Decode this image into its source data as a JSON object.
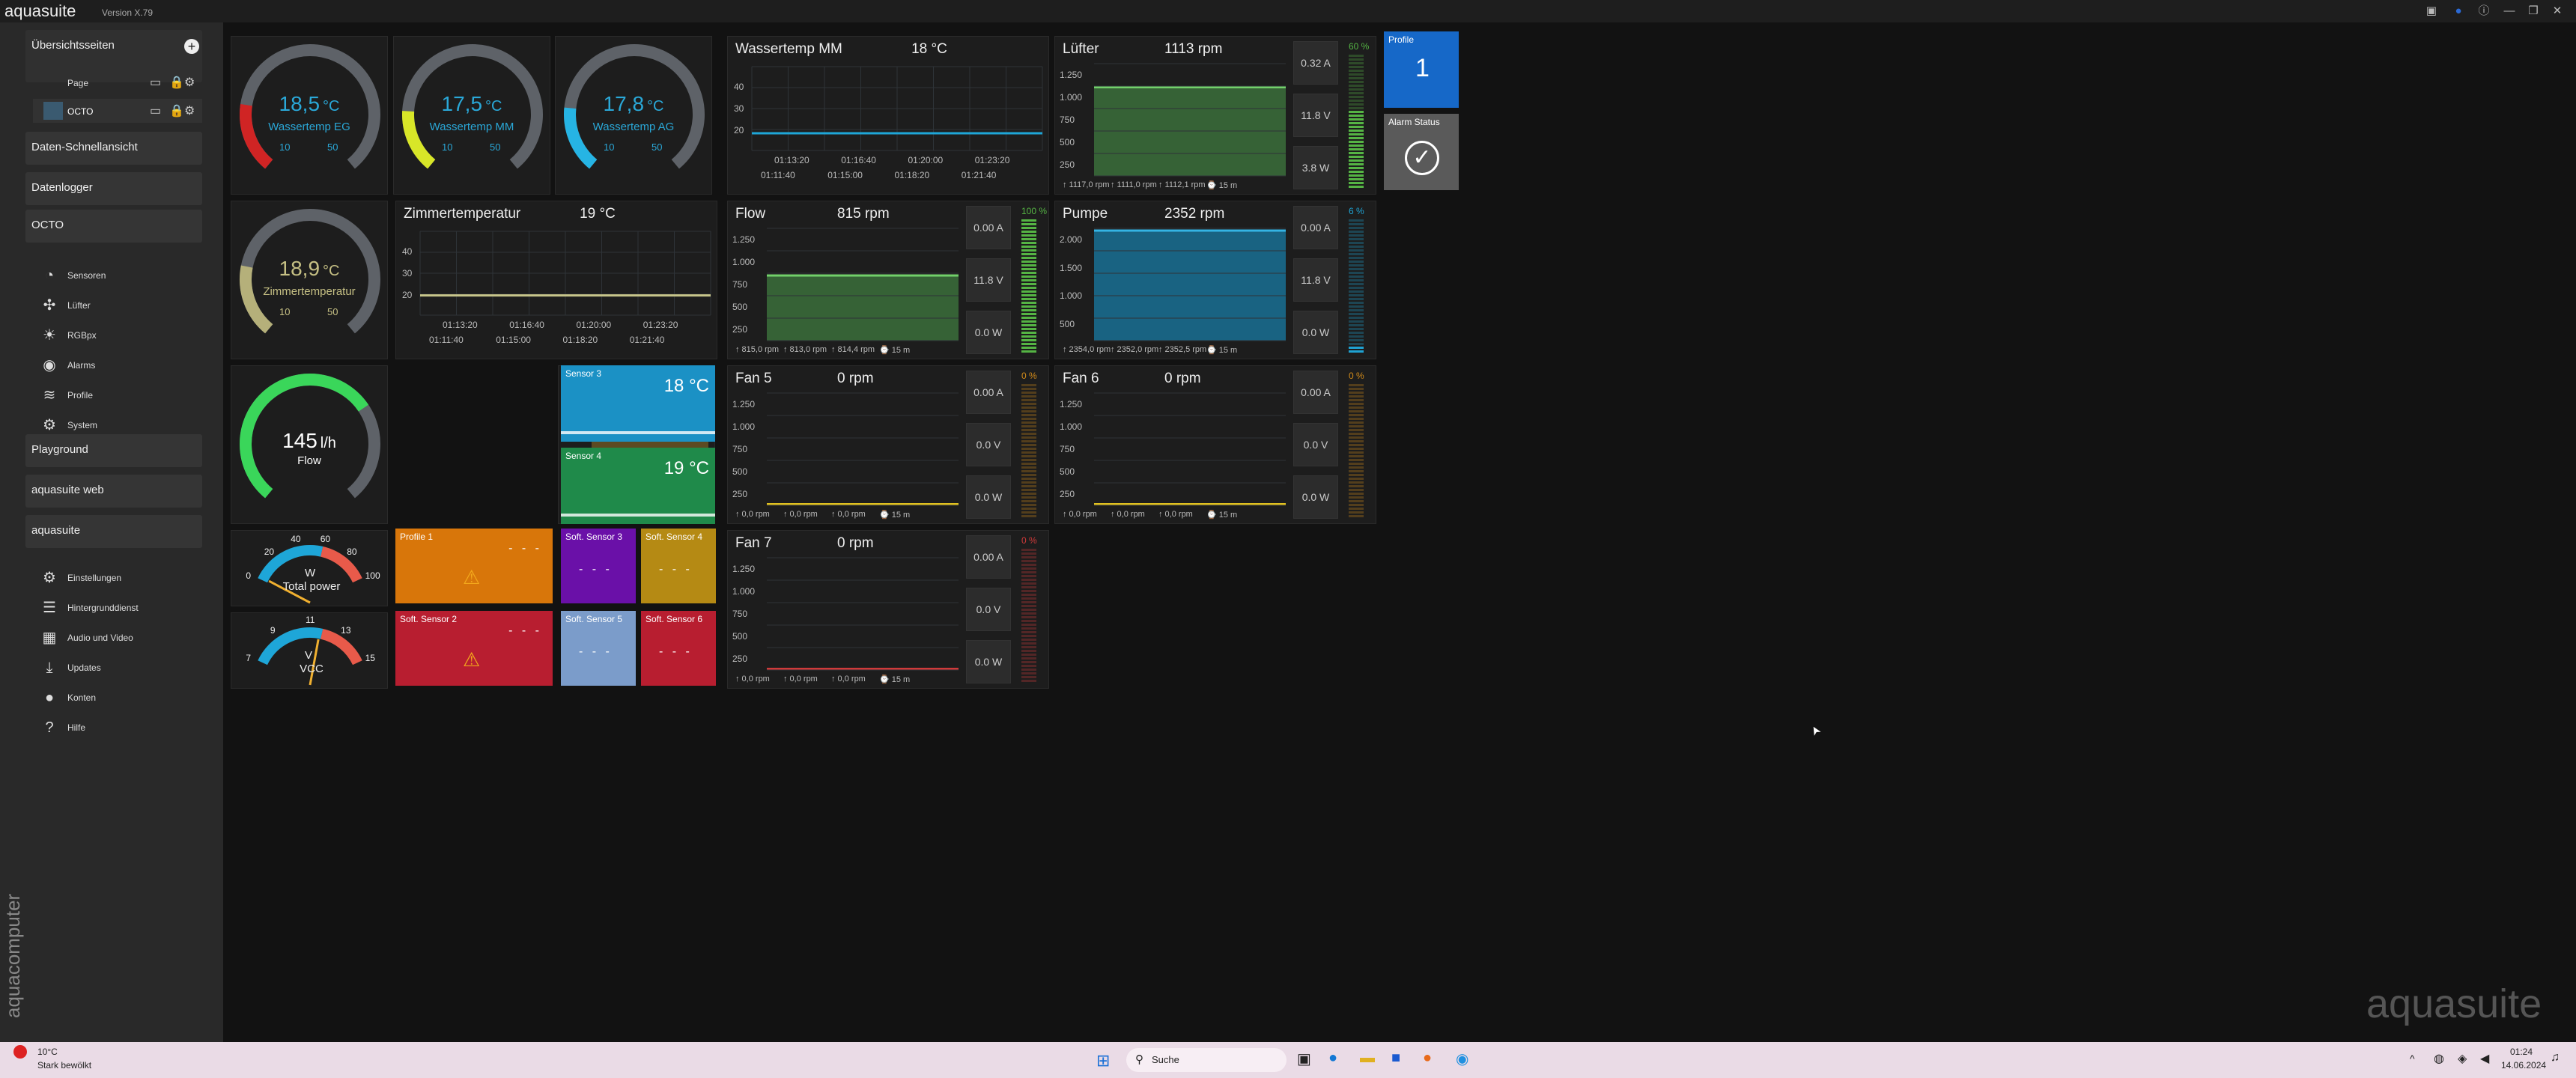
{
  "app": {
    "name": "aquasuite",
    "version": "Version X.79"
  },
  "window": {
    "icons": [
      "screenshot-icon",
      "globe-icon",
      "info-icon"
    ],
    "min": "—",
    "restore": "❐",
    "close": "✕"
  },
  "sidebar": {
    "overview": "Übersichtsseiten",
    "add": "+",
    "pages": [
      {
        "label": "Page"
      },
      {
        "label": "OCTO"
      }
    ],
    "quick": "Daten-Schnellansicht",
    "logger": "Datenlogger",
    "octo": "OCTO",
    "octo_items": [
      {
        "label": "Sensoren",
        "icon": "gauge-icon",
        "g": "◔"
      },
      {
        "label": "Lüfter",
        "icon": "fan-icon",
        "g": "✣"
      },
      {
        "label": "RGBpx",
        "icon": "bulb-icon",
        "g": "☀"
      },
      {
        "label": "Alarms",
        "icon": "alarm-icon",
        "g": "◉"
      },
      {
        "label": "Profile",
        "icon": "layers-icon",
        "g": "≋"
      },
      {
        "label": "System",
        "icon": "gear-icon",
        "g": "⚙"
      }
    ],
    "playground": "Playground",
    "web": "aquasuite web",
    "aquasuite": "aquasuite",
    "aq_items": [
      {
        "label": "Einstellungen",
        "icon": "gear-icon",
        "g": "⚙"
      },
      {
        "label": "Hintergrunddienst",
        "icon": "list-icon",
        "g": "☰"
      },
      {
        "label": "Audio und Video",
        "icon": "film-icon",
        "g": "▦"
      },
      {
        "label": "Updates",
        "icon": "download-icon",
        "g": "⤓"
      },
      {
        "label": "Konten",
        "icon": "user-icon",
        "g": "●"
      },
      {
        "label": "Hilfe",
        "icon": "help-icon",
        "g": "?"
      }
    ],
    "brand": "aquacomputer"
  },
  "gauges": [
    {
      "v": "18,5",
      "u": "°C",
      "label": "Wassertemp EG",
      "min": "10",
      "max": "50",
      "frac": 0.21,
      "color": "#d02424",
      "text": "#2aa8d8"
    },
    {
      "v": "17,5",
      "u": "°C",
      "label": "Wassertemp MM",
      "min": "10",
      "max": "50",
      "frac": 0.19,
      "color": "#d8e628",
      "text": "#2aa8d8"
    },
    {
      "v": "17,8",
      "u": "°C",
      "label": "Wassertemp AG",
      "min": "10",
      "max": "50",
      "frac": 0.2,
      "color": "#26b4e4",
      "text": "#2aa8d8"
    },
    {
      "v": "18,9",
      "u": "°C",
      "label": "Zimmertemperatur",
      "min": "10",
      "max": "50",
      "frac": 0.22,
      "color": "#b5b07a",
      "text": "#c6c084"
    },
    {
      "v": "145",
      "u": "l/h",
      "label": "Flow",
      "frac": 0.7,
      "color": "#3ad65a",
      "text": "#fff"
    }
  ],
  "lines": [
    {
      "title": "Wassertemp MM",
      "value": "18 °C",
      "y": [
        "40",
        "30",
        "20"
      ],
      "x": [
        "01:11:40",
        "01:15:00",
        "01:18:20",
        "01:21:40"
      ],
      "x2": [
        "01:13:20",
        "01:16:40",
        "01:20:00",
        "01:23:20"
      ],
      "color": "#1ea6d8",
      "level": 0.17
    },
    {
      "title": "Zimmertemperatur",
      "value": "19 °C",
      "y": [
        "40",
        "30",
        "20"
      ],
      "x": [
        "01:11:40",
        "01:15:00",
        "01:18:20",
        "01:21:40"
      ],
      "x2": [
        "01:13:20",
        "01:16:40",
        "01:20:00",
        "01:23:20"
      ],
      "color": "#c7c58a",
      "level": 0.2
    }
  ],
  "fans": [
    {
      "title": "Lüfter",
      "value": "1113 rpm",
      "a": "0.32 A",
      "v": "11.8 V",
      "w": "3.8 W",
      "pct": "60 %",
      "pctv": 0.6,
      "bcolor": "#55b444",
      "fill": "#3a6a3a",
      "line": "#72d06a",
      "level": 0.79,
      "y": [
        "1.250",
        "1.000",
        "750",
        "500",
        "250"
      ],
      "foot": [
        "↑ 1117,0 rpm",
        "↑ 1111,0 rpm",
        "↑ 1112,1 rpm",
        "⌚ 15 m"
      ]
    },
    {
      "title": "Flow",
      "value": "815 rpm",
      "a": "0.00 A",
      "v": "11.8 V",
      "w": "0.0 W",
      "pct": "100 %",
      "pctv": 1,
      "bcolor": "#55b444",
      "fill": "#3a6a3a",
      "line": "#72d06a",
      "level": 0.58,
      "y": [
        "1.250",
        "1.000",
        "750",
        "500",
        "250"
      ],
      "foot": [
        "↑ 815,0 rpm",
        "↑ 813,0 rpm",
        "↑ 814,4 rpm",
        "⌚ 15 m"
      ]
    },
    {
      "title": "Pumpe",
      "value": "2352 rpm",
      "a": "0.00 A",
      "v": "11.8 V",
      "w": "0.0 W",
      "pct": "6 %",
      "pctv": 0.06,
      "bcolor": "#1fa2d2",
      "fill": "#1a6c8e",
      "line": "#34b4e4",
      "level": 0.98,
      "y": [
        "2.000",
        "1.500",
        "1.000",
        "500"
      ],
      "foot": [
        "↑ 2354,0 rpm",
        "↑ 2352,0 rpm",
        "↑ 2352,5 rpm",
        "⌚ 15 m"
      ]
    },
    {
      "title": "Fan 5",
      "value": "0 rpm",
      "a": "0.00 A",
      "v": "0.0 V",
      "w": "0.0 W",
      "pct": "0 %",
      "pctv": 0,
      "bcolor": "#d28b1a",
      "fill": "#1d1d1d",
      "line": "#e0c020",
      "level": 0.01,
      "y": [
        "1.250",
        "1.000",
        "750",
        "500",
        "250"
      ],
      "foot": [
        "↑ 0,0 rpm",
        "↑ 0,0 rpm",
        "↑ 0,0 rpm",
        "⌚ 15 m"
      ]
    },
    {
      "title": "Fan 6",
      "value": "0 rpm",
      "a": "0.00 A",
      "v": "0.0 V",
      "w": "0.0 W",
      "pct": "0 %",
      "pctv": 0,
      "bcolor": "#d28b1a",
      "fill": "#1d1d1d",
      "line": "#e0c020",
      "level": 0.01,
      "y": [
        "1.250",
        "1.000",
        "750",
        "500",
        "250"
      ],
      "foot": [
        "↑ 0,0 rpm",
        "↑ 0,0 rpm",
        "↑ 0,0 rpm",
        "⌚ 15 m"
      ]
    },
    {
      "title": "Fan 7",
      "value": "0 rpm",
      "a": "0.00 A",
      "v": "0.0 V",
      "w": "0.0 W",
      "pct": "0 %",
      "pctv": 0,
      "bcolor": "#d03a3a",
      "fill": "#1d1d1d",
      "line": "#d03a3a",
      "level": 0.01,
      "y": [
        "1.250",
        "1.000",
        "750",
        "500",
        "250"
      ],
      "foot": [
        "↑ 0,0 rpm",
        "↑ 0,0 rpm",
        "↑ 0,0 rpm",
        "⌚ 15 m"
      ]
    }
  ],
  "flow_bar": {
    "title": "Flow",
    "value": "145 l/h",
    "y": [
      "200",
      "150",
      "100",
      "50"
    ],
    "level": 0.725,
    "color": "#e0a020"
  },
  "sensors": [
    {
      "name": "Sensor 3",
      "value": "18 °C",
      "color": "#1b91c5"
    },
    {
      "name": "Sensor 4",
      "value": "19 °C",
      "color": "#1f8a4a"
    }
  ],
  "soft": [
    {
      "name": "Profile 1",
      "color": "#d8760a",
      "dash": "- - -",
      "warn": true
    },
    {
      "name": "Soft. Sensor 3",
      "color": "#6a10a8",
      "dash": "- - -"
    },
    {
      "name": "Soft. Sensor 4",
      "color": "#b58a14",
      "dash": "- - -"
    },
    {
      "name": "Soft. Sensor 2",
      "color": "#b81e30",
      "dash": "- - -",
      "warn": true
    },
    {
      "name": "Soft. Sensor 5",
      "color": "#7b9cca",
      "dash": "- - -"
    },
    {
      "name": "Soft. Sensor 6",
      "color": "#b81e30",
      "dash": "- - -"
    }
  ],
  "meters": [
    {
      "unit": "W",
      "label": "Total power",
      "ticks": [
        "0",
        "20",
        "40",
        "60",
        "80",
        "100"
      ],
      "frac": 0.02
    },
    {
      "unit": "V",
      "label": "VCC",
      "ticks": [
        "7",
        "9",
        "11",
        "13",
        "15"
      ],
      "frac": 0.58
    }
  ],
  "profile": {
    "label": "Profile",
    "value": "1"
  },
  "alarm": {
    "label": "Alarm Status"
  },
  "watermark": "aquasuite",
  "taskbar": {
    "temp": "10°C",
    "weather": "Stark bewölkt",
    "search": "Suche",
    "time": "01:24",
    "date": "14.06.2024"
  }
}
